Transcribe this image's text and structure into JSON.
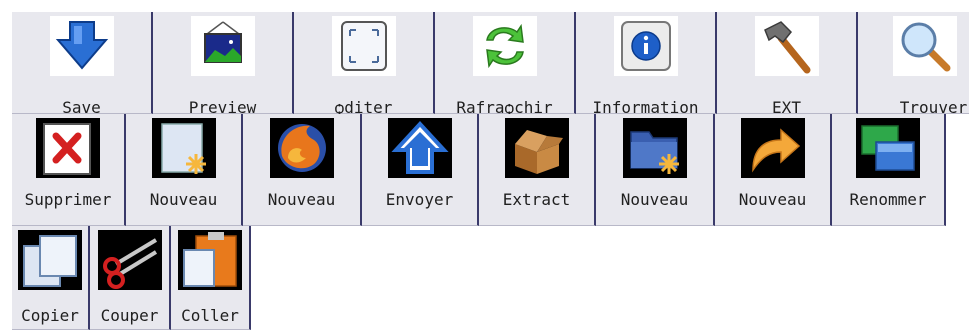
{
  "toolbar": {
    "row1": [
      {
        "label": "Save",
        "icon": "save-icon"
      },
      {
        "label": "Preview",
        "icon": "preview-icon"
      },
      {
        "label": "ѻditer",
        "icon": "edit-icon"
      },
      {
        "label": "Rafraѻchir",
        "icon": "refresh-icon"
      },
      {
        "label": "Information",
        "icon": "info-icon"
      },
      {
        "label": "EXT",
        "icon": "hammer-icon"
      },
      {
        "label": "Trouver",
        "icon": "search-icon"
      }
    ],
    "row2": [
      {
        "label": "Supprimer",
        "icon": "delete-icon"
      },
      {
        "label": "Nouveau",
        "icon": "new-file-icon"
      },
      {
        "label": "Nouveau",
        "icon": "firefox-icon"
      },
      {
        "label": "Envoyer",
        "icon": "upload-icon"
      },
      {
        "label": "Extract",
        "icon": "open-box-icon"
      },
      {
        "label": "Nouveau",
        "icon": "new-folder-icon"
      },
      {
        "label": "Nouveau",
        "icon": "redo-arrow-icon"
      },
      {
        "label": "Renommer",
        "icon": "rename-icon"
      }
    ],
    "row3": [
      {
        "label": "Copier",
        "icon": "copy-icon"
      },
      {
        "label": "Couper",
        "icon": "scissors-icon"
      },
      {
        "label": "Coller",
        "icon": "paste-icon"
      }
    ]
  }
}
